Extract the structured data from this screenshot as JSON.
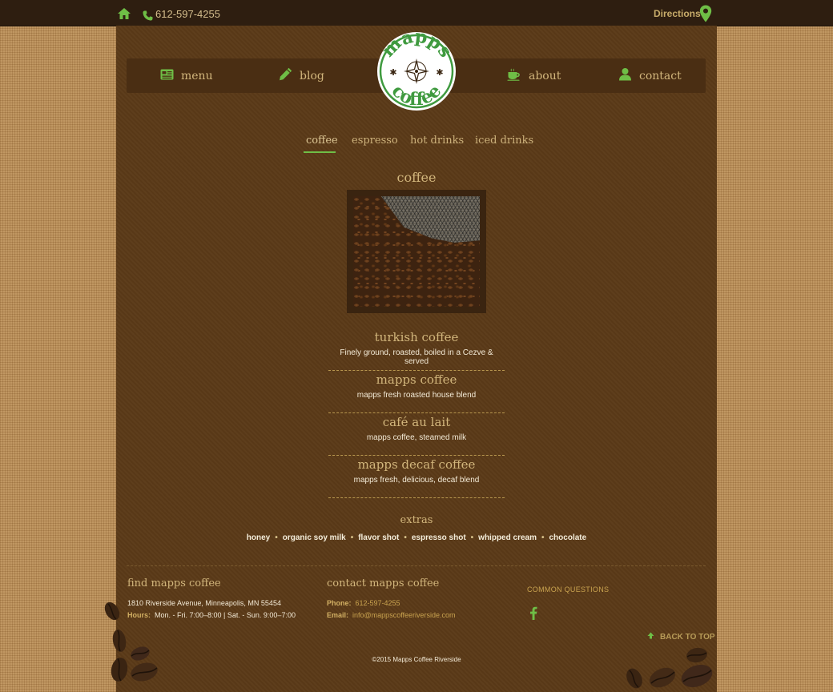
{
  "topbar": {
    "phone": "612-597-4255",
    "directions": "Directions"
  },
  "logo": {
    "top_word": "mapps",
    "bottom_word": "coffee"
  },
  "nav": {
    "items": [
      {
        "label": "menu",
        "icon": "menu-icon"
      },
      {
        "label": "blog",
        "icon": "pencil-icon"
      },
      {
        "label": "about",
        "icon": "coffee-cup-icon"
      },
      {
        "label": "contact",
        "icon": "person-icon"
      }
    ]
  },
  "tabs": [
    {
      "label": "coffee",
      "active": true
    },
    {
      "label": "espresso",
      "active": false
    },
    {
      "label": "hot drinks",
      "active": false
    },
    {
      "label": "iced drinks",
      "active": false
    }
  ],
  "section": {
    "title": "coffee",
    "items": [
      {
        "name": "turkish coffee",
        "desc": "Finely ground, roasted, boiled in a Cezve & served"
      },
      {
        "name": "mapps coffee",
        "desc": "mapps fresh roasted house blend"
      },
      {
        "name": "café au lait",
        "desc": "mapps coffee, steamed milk"
      },
      {
        "name": "mapps decaf coffee",
        "desc": "mapps fresh, delicious, decaf blend"
      }
    ]
  },
  "extras": {
    "title": "extras",
    "items": [
      "honey",
      "organic soy milk",
      "flavor shot",
      "espresso shot",
      "whipped cream",
      "chocolate"
    ],
    "separator": "•"
  },
  "footer": {
    "find_title": "find mapps coffee",
    "address": "1810 Riverside Avenue, Minneapolis, MN 55454",
    "hours_label": "Hours:",
    "hours": "Mon. - Fri. 7:00–8:00 | Sat. - Sun. 9:00–7:00",
    "contact_title": "contact mapps coffee",
    "phone_label": "Phone:",
    "phone": "612-597-4255",
    "email_label": "Email:",
    "email": "info@mappscoffeeriverside.com",
    "common_questions": "COMMON QUESTIONS",
    "back_to_top": "BACK TO TOP",
    "copyright": "©2015 Mapps Coffee Riverside"
  },
  "colors": {
    "accent_green": "#6fbe46",
    "gold_text": "#d2b67c",
    "panel_brown": "#5b3a18",
    "topbar_brown": "#2e1e10"
  }
}
